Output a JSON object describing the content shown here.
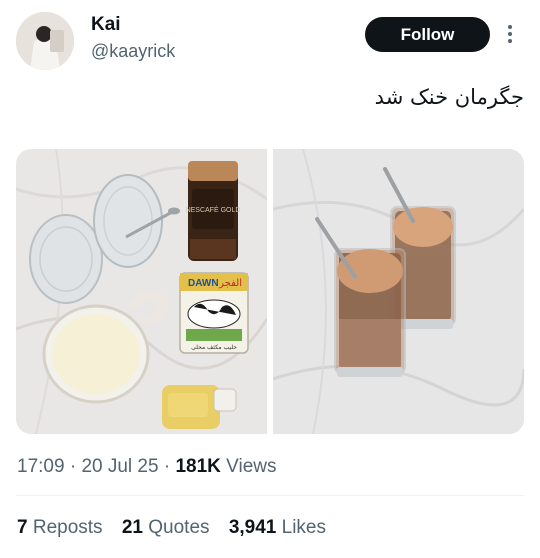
{
  "author": {
    "name": "Kai",
    "handle": "@kaayrick"
  },
  "follow_label": "Follow",
  "tweet_text": "جگرمان خنک شد",
  "media": {
    "left_photo": {
      "coffee_jar_text": "NESCAFÉ GOLD",
      "milk_tin_text": "الفجر",
      "milk_tin_caption": "حليب مكثف محلى",
      "milk_tin_brand": "DAWN"
    }
  },
  "meta": {
    "time": "17:09",
    "date": "20 Jul 25",
    "views_count": "181K",
    "views_label": "Views",
    "separator": "·"
  },
  "stats": {
    "reposts_count": "7",
    "reposts_label": "Reposts",
    "quotes_count": "21",
    "quotes_label": "Quotes",
    "likes_count": "3,941",
    "likes_label": "Likes"
  }
}
